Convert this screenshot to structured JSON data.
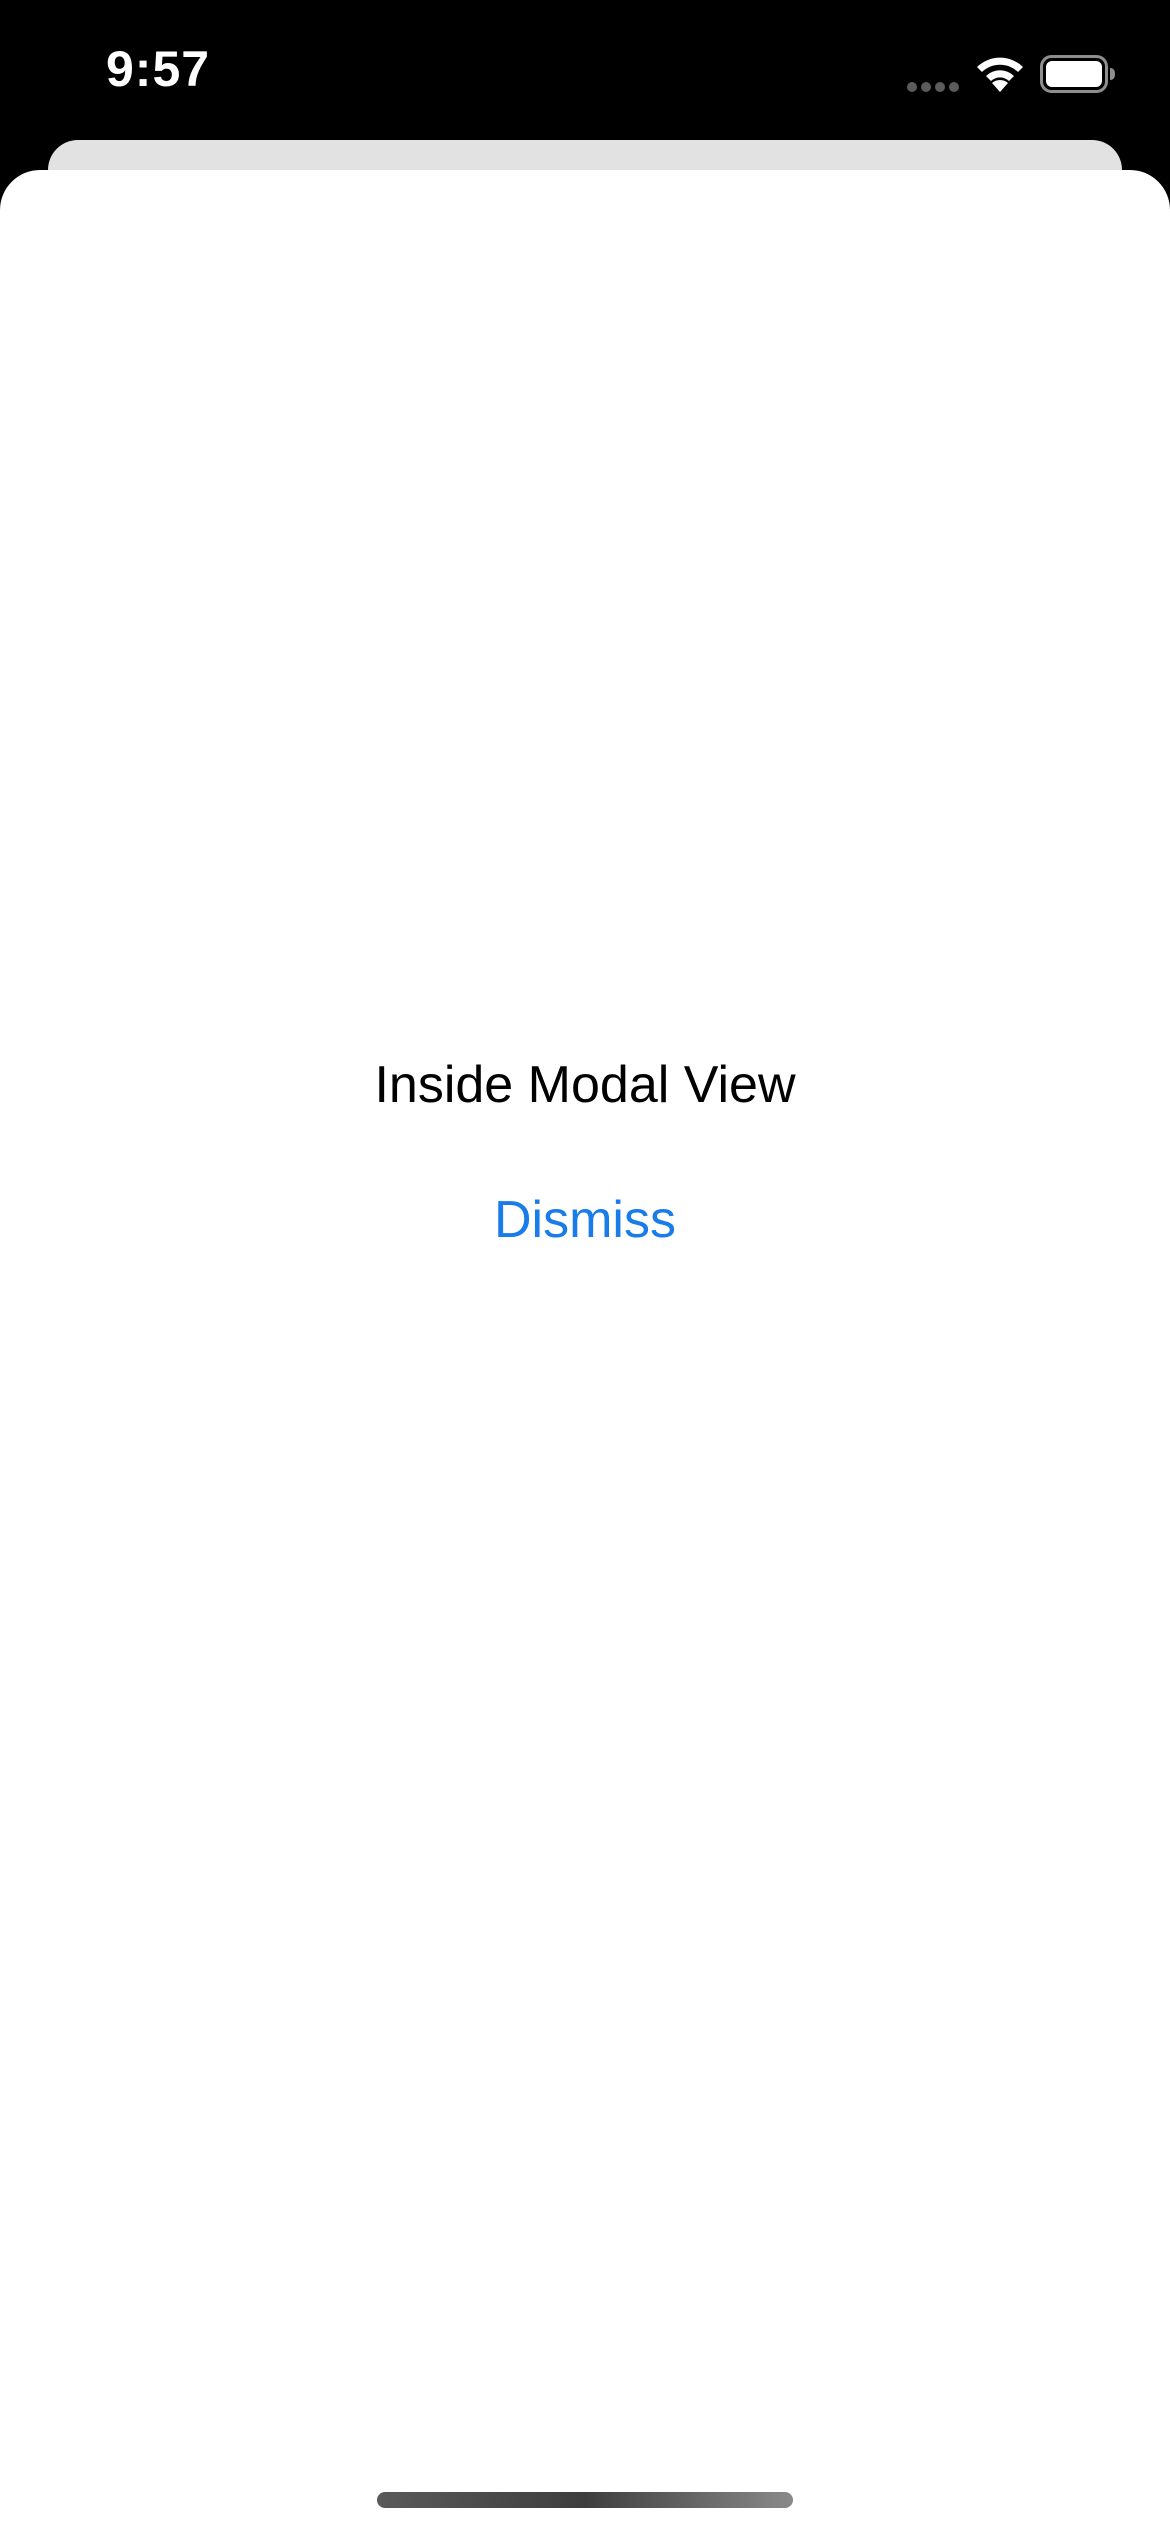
{
  "status_bar": {
    "time": "9:57",
    "icons": [
      "cellular-signal-icon",
      "wifi-icon",
      "battery-icon"
    ]
  },
  "modal": {
    "message": "Inside Modal View",
    "dismiss_label": "Dismiss"
  },
  "colors": {
    "status_background": "#000000",
    "modal_background": "#ffffff",
    "back_sheet": "#e2e2e2",
    "accent": "#1a7ce8",
    "text": "#000000"
  }
}
